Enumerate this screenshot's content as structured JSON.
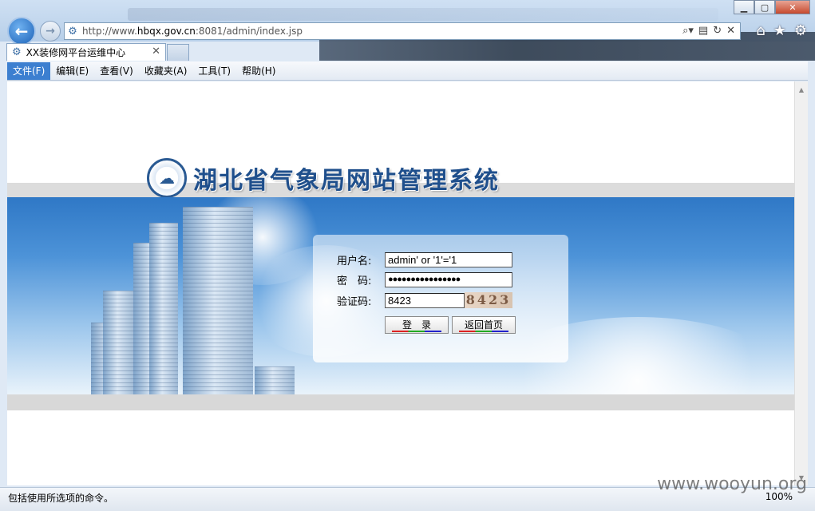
{
  "browser": {
    "address_prefix": "http://www.",
    "address_domain": "hbqx.gov.cn",
    "address_suffix": ":8081/admin/index.jsp",
    "tab_title": "XX装修网平台运维中心",
    "menu": [
      "文件(F)",
      "编辑(E)",
      "查看(V)",
      "收藏夹(A)",
      "工具(T)",
      "帮助(H)"
    ],
    "status_text": "包括使用所选项的命令。",
    "zoom": "100%"
  },
  "page": {
    "site_title": "湖北省气象局网站管理系统",
    "login": {
      "username_label": "用户名:",
      "username_value": "admin' or '1'='1",
      "password_label": "密　码:",
      "password_value": "●●●●●●●●●●●●●●●●",
      "captcha_label": "验证码:",
      "captcha_value": "8423",
      "captcha_image_text": "8423",
      "login_button": "登　录",
      "home_button": "返回首页"
    }
  },
  "watermark": "www.wooyun.org"
}
